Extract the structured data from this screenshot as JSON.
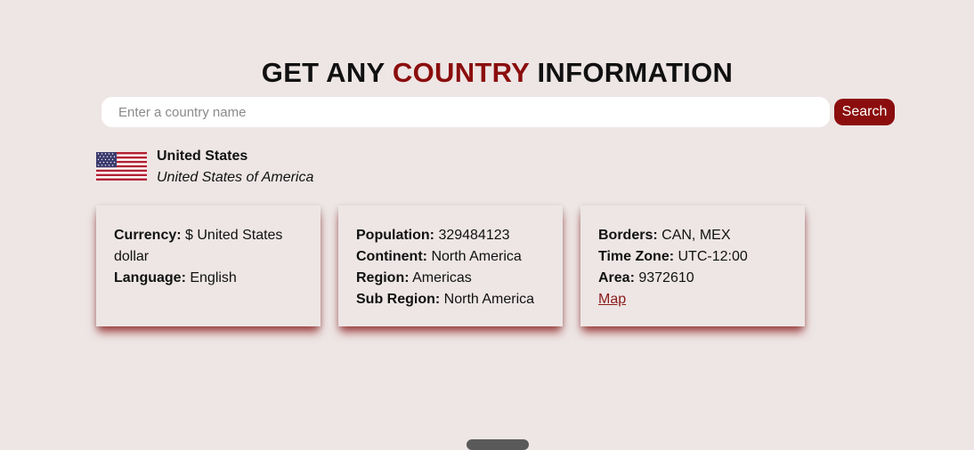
{
  "header": {
    "title_prefix": "GET ANY",
    "title_accent": "COUNTRY",
    "title_suffix": "INFORMATION"
  },
  "search": {
    "placeholder": "Enter a country name",
    "value": "",
    "button_label": "Search"
  },
  "country": {
    "flag_icon": "us-flag-icon",
    "common_name": "United States",
    "official_name": "United States of America"
  },
  "cards": {
    "currency_label": "Currency:",
    "currency_value": "$ United States dollar",
    "language_label": "Language:",
    "language_value": "English",
    "population_label": "Population:",
    "population_value": "329484123",
    "continent_label": "Continent:",
    "continent_value": "North America",
    "region_label": "Region:",
    "region_value": "Americas",
    "subregion_label": "Sub Region:",
    "subregion_value": "North America",
    "borders_label": "Borders:",
    "borders_value": "CAN, MEX",
    "timezone_label": "Time Zone:",
    "timezone_value": "UTC-12:00",
    "area_label": "Area:",
    "area_value": "9372610",
    "map_link": "Map"
  },
  "colors": {
    "accent": "#8b0d0d",
    "background": "#ede6e5"
  }
}
